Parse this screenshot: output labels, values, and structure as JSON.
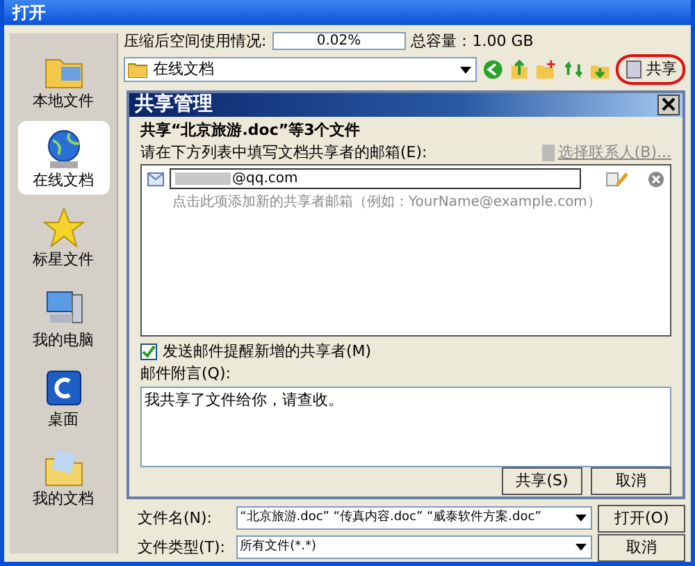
{
  "window": {
    "title": "打开"
  },
  "sidebar": {
    "items": [
      {
        "label": "本地文件",
        "selected": false
      },
      {
        "label": "在线文档",
        "selected": true
      },
      {
        "label": "标星文件",
        "selected": false
      },
      {
        "label": "我的电脑",
        "selected": false
      },
      {
        "label": "桌面",
        "selected": false
      },
      {
        "label": "我的文档",
        "selected": false
      }
    ]
  },
  "usage": {
    "label": "压缩后空间使用情况:",
    "level": 0.0002,
    "reading": "0.02%",
    "capacity": "总容量：1.00 GB"
  },
  "location": {
    "value": "在线文档"
  },
  "toolbar": {
    "share_button": "共享"
  },
  "share_dialog": {
    "title": "共享管理",
    "heading": "共享“北京旅游.doc”等3个文件",
    "prompt": "请在下方列表中填写文档共享者的邮箱(E):",
    "contacts_link": "选择联系人(B)...",
    "recipients": [
      {
        "email": "@qq.com"
      }
    ],
    "add_hint": "点击此项添加新的共享者邮箱（例如：YourName@example.com）",
    "notify": {
      "label": "发送邮件提醒新增的共享者(M)",
      "checked": true
    },
    "message_label": "邮件附言(Q):",
    "message": "我共享了文件给你，请查收。",
    "buttons": [
      "共享(S)",
      "取消"
    ]
  },
  "file_name": {
    "label": "文件名(N):",
    "value": "“北京旅游.doc” “传真内容.doc” “威泰软件方案.doc”"
  },
  "open_button": "打开(O)",
  "file_type": {
    "label": "文件类型(T):",
    "value": "所有文件(*.*)"
  },
  "cancel_button": "取消"
}
